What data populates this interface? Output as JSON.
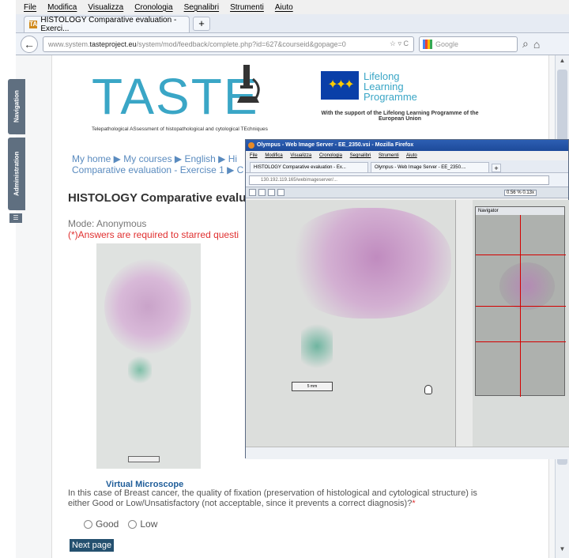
{
  "browser": {
    "menu": [
      "File",
      "Modifica",
      "Visualizza",
      "Cronologia",
      "Segnalibri",
      "Strumenti",
      "Aiuto"
    ],
    "tab_title": "HISTOLOGY Comparative evaluation - Exerci...",
    "tab_favicon": "TA",
    "newtab": "+",
    "back": "←",
    "url_prefix": "www.system.",
    "url_domain": "tasteproject.eu",
    "url_path": "/system/mod/feedback/complete.php?id=627&courseid&gopage=0",
    "search_placeholder": "Google",
    "star": "☆ ▿ C",
    "magnifier": "⌕",
    "home": "⌂"
  },
  "dock": {
    "navigation": "Navigation",
    "administration": "Administration",
    "icon": "☰"
  },
  "header": {
    "logo_word": "TASTE",
    "logo_sub": "Telepathological ASsessment of histopathological and cytological TEchniques",
    "eu_programme": [
      "Lifelong",
      "Learning",
      "Programme"
    ],
    "eu_caption": "With the support of the Lifelong Learning Programme of the European Union"
  },
  "breadcrumb": {
    "line1": "My home ▶ My courses ▶ English ▶ Hi",
    "line2": "Comparative evaluation - Exercise 1 ▶ C"
  },
  "main": {
    "heading": "HISTOLOGY Comparative evalua",
    "mode": "Mode: Anonymous",
    "required_note": "(*)Answers are required to starred questi",
    "virtual_microscope": "Virtual Microscope",
    "question": "In this case of Breast cancer, the quality of fixation (preservation of histological and cytological structure) is either Good or Low/Unsatisfactory (not acceptable, since it prevents a correct diagnosis)?",
    "question_star": "*",
    "options": [
      "Good",
      "Low"
    ],
    "next_button": "Next page"
  },
  "popup": {
    "title": "Olympus - Web Image Server - EE_2350.vsi - Mozilla Firefox",
    "menu": [
      "File",
      "Modifica",
      "Visualizza",
      "Cronologia",
      "Segnalibri",
      "Strumenti",
      "Aiuto"
    ],
    "tab1": "HISTOLOGY Comparative evaluation - Ex...",
    "tab2": "Olympus - Web Image Server - EE_2350....",
    "url": "130.192.119.165/webimageserver/...",
    "zoom": "0.56 % 0.13x",
    "scale": "5 mm",
    "navigator_title": "Navigator"
  }
}
